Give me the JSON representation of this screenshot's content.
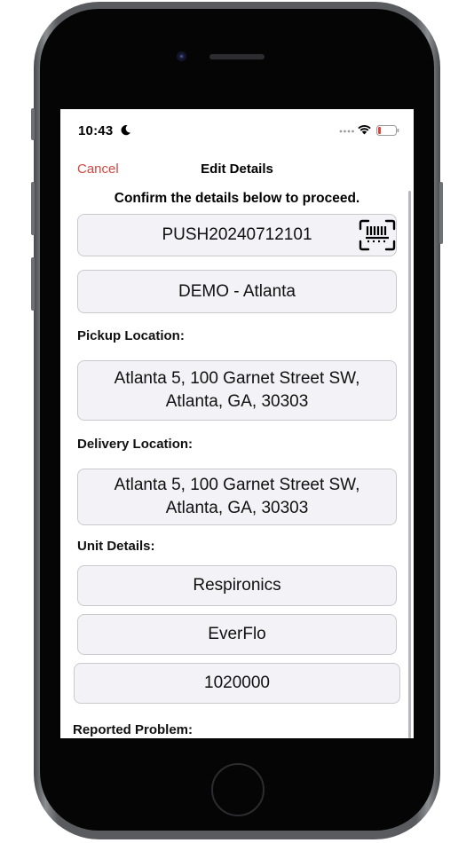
{
  "status_bar": {
    "time": "10:43"
  },
  "nav": {
    "cancel": "Cancel",
    "title": "Edit Details"
  },
  "instruction": "Confirm the details below to proceed.",
  "order_id": "PUSH20240712101",
  "account": "DEMO - Atlanta",
  "pickup": {
    "label": "Pickup Location:",
    "line1": "Atlanta 5, 100 Garnet Street SW,",
    "line2": "Atlanta, GA, 30303"
  },
  "delivery": {
    "label": "Delivery Location:",
    "line1": "Atlanta 5, 100 Garnet Street SW,",
    "line2": "Atlanta, GA, 30303"
  },
  "unit": {
    "label": "Unit Details:",
    "manufacturer": "Respironics",
    "model": "EverFlo",
    "serial": "1020000"
  },
  "reported_problem": {
    "label": "Reported Problem:"
  },
  "colors": {
    "accent": "#d64540",
    "field_bg": "#f2f2f7",
    "field_border": "#c9c9ce"
  },
  "icons": [
    "moon-icon",
    "signal-icon",
    "wifi-icon",
    "battery-icon",
    "barcode-scan-icon"
  ]
}
